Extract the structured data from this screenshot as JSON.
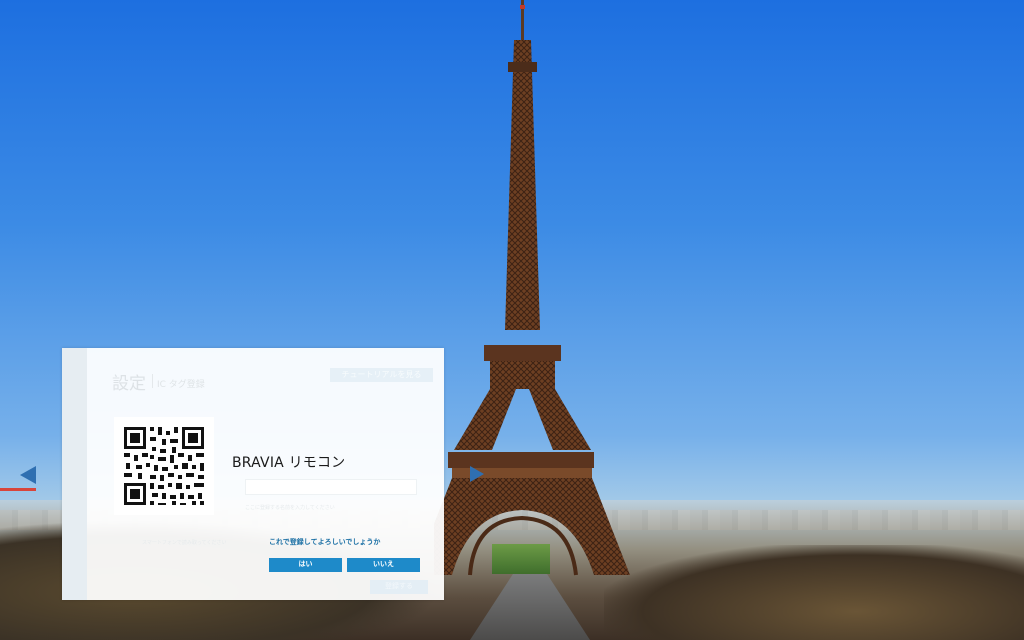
{
  "colors": {
    "accent": "#1e8ac9",
    "confirm_text": "#1a6fa4",
    "nav_arrow": "#2f6fb1",
    "tower": "#6b3e22"
  },
  "nav": {
    "prev_icon": "left-triangle",
    "next_icon": "right-triangle"
  },
  "panel": {
    "title": "設定",
    "subtitle": "IC タグ登録",
    "tutorial_button": "チュートリアルを見る",
    "qr_icon": "qr-code",
    "app_title": "BRAVIA リモコン",
    "name_input_value": "",
    "hint_text": "ここに登録する名前を入力してください",
    "qr_caption": "スマートフォンで読み取ってください",
    "confirm_text": "これで登録してよろしいでしょうか",
    "yes_button": "はい",
    "no_button": "いいえ",
    "register_button": "登録する"
  }
}
